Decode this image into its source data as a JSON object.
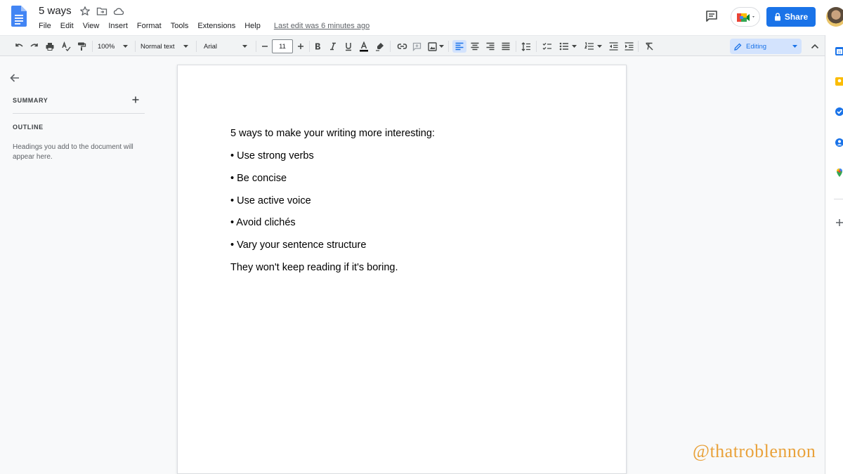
{
  "document": {
    "title": "5 ways",
    "last_edit": "Last edit was 6 minutes ago",
    "lines": [
      "5 ways to make your writing more interesting:",
      "• Use strong verbs",
      "• Be concise",
      "• Use active voice",
      "• Avoid clichés",
      "• Vary your sentence structure",
      "They won't keep reading if it's boring."
    ]
  },
  "menu": [
    "File",
    "Edit",
    "View",
    "Insert",
    "Format",
    "Tools",
    "Extensions",
    "Help"
  ],
  "header": {
    "share_label": "Share"
  },
  "toolbar": {
    "zoom": "100%",
    "style": "Normal text",
    "font": "Arial",
    "size": "11",
    "mode": "Editing"
  },
  "sidebar": {
    "summary_label": "SUMMARY",
    "outline_label": "OUTLINE",
    "outline_hint": "Headings you add to the document will appear here."
  },
  "watermark": "@thatroblennon",
  "colors": {
    "accent": "#1a73e8",
    "docs_blue": "#4285f4",
    "editing_bg": "#d3e3fd",
    "watermark": "#e9a23b"
  }
}
